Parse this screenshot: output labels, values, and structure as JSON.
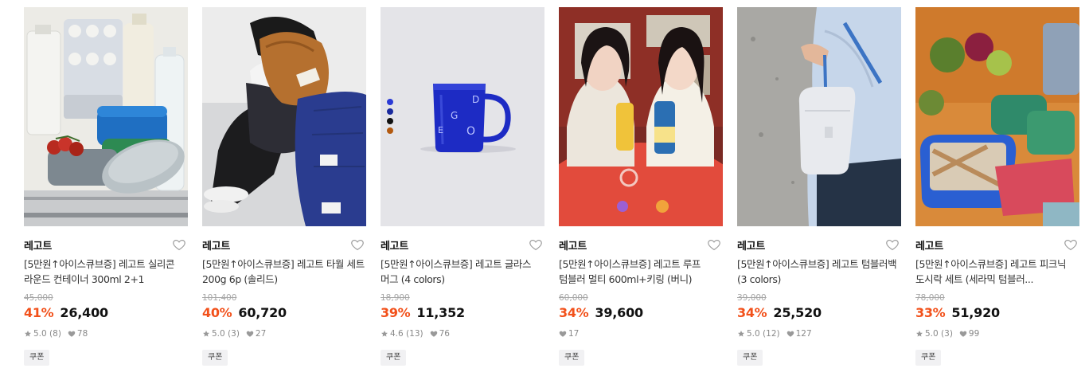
{
  "products": [
    {
      "brand": "레고트",
      "title": "[5만원↑아이스큐브증] 레고트 실리콘 라운드 컨테이너 300ml 2+1",
      "original_price": "45,000",
      "discount": "41%",
      "price": "26,400",
      "rating": "5.0 (8)",
      "likes": "78",
      "badge": "쿠폰"
    },
    {
      "brand": "레고트",
      "title": "[5만원↑아이스큐브증] 레고트 타월 세트 200g 6p (솔리드)",
      "original_price": "101,400",
      "discount": "40%",
      "price": "60,720",
      "rating": "5.0 (3)",
      "likes": "27",
      "badge": "쿠폰"
    },
    {
      "brand": "레고트",
      "title": "[5만원↑아이스큐브증] 레고트 글라스 머그 (4 colors)",
      "original_price": "18,900",
      "discount": "39%",
      "price": "11,352",
      "rating": "4.6 (13)",
      "likes": "76",
      "badge": "쿠폰",
      "mug_letters": [
        "D",
        "G",
        "E",
        "O"
      ],
      "swatches": [
        "#2b3bd6",
        "#1a2a9e",
        "#111111",
        "#b35a10"
      ]
    },
    {
      "brand": "레고트",
      "title": "[5만원↑아이스큐브증] 레고트 루프 텀블러 멀티 600ml+키링 (버니)",
      "original_price": "60,000",
      "discount": "34%",
      "price": "39,600",
      "likes": "17",
      "badge": "쿠폰"
    },
    {
      "brand": "레고트",
      "title": "[5만원↑아이스큐브증] 레고트 텀블러백 (3 colors)",
      "original_price": "39,000",
      "discount": "34%",
      "price": "25,520",
      "rating": "5.0 (12)",
      "likes": "127",
      "badge": "쿠폰"
    },
    {
      "brand": "레고트",
      "title": "[5만원↑아이스큐브증] 레고트 피크닉 도시락 세트 (세라믹 텀블러...",
      "original_price": "78,000",
      "discount": "33%",
      "price": "51,920",
      "rating": "5.0 (3)",
      "likes": "99",
      "badge": "쿠폰"
    }
  ],
  "colors": {
    "discount": "#f2511b",
    "muted": "#888888",
    "badge_bg": "#f1f1f3"
  },
  "icons": {
    "wishlist": "heart-outline-icon",
    "rating": "star-icon",
    "likes": "heart-filled-icon"
  }
}
